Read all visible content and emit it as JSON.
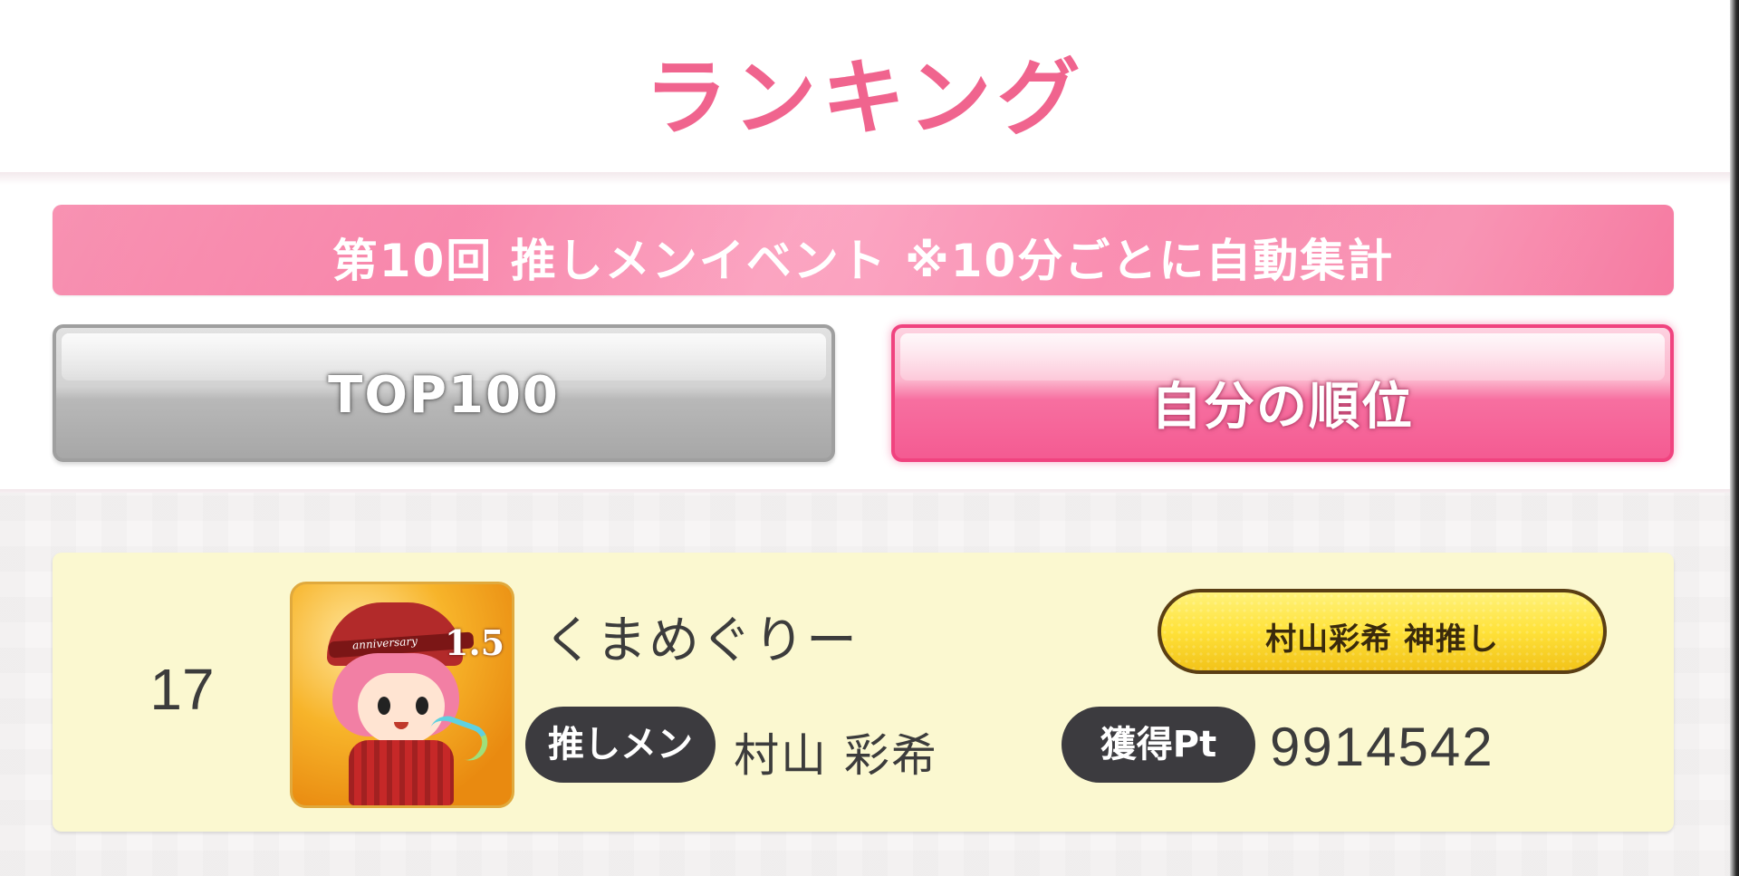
{
  "header": {
    "title": "ランキング"
  },
  "event_banner": {
    "text": "第10回 推しメンイベント ※10分ごとに自動集計"
  },
  "tabs": [
    {
      "label": "TOP100",
      "selected": false
    },
    {
      "label": "自分の順位",
      "selected": true
    }
  ],
  "ranking_entry": {
    "rank": "17",
    "player_name": "くまめぐりー",
    "avatar_text": {
      "band": "anniversary",
      "number": "1.5"
    },
    "title_badge": "村山彩希 神推し",
    "oshimen_label": "推しメン",
    "oshimen_name": "村山 彩希",
    "points_label": "獲得Pt",
    "points_value": "9914542"
  },
  "colors": {
    "title_pink": "#f0648e",
    "banner_pink": "#f67aa1",
    "tab_selected_pink": "#f45b92",
    "tab_unselected_gray": "#b8b8b8",
    "card_background": "#fbf8d0",
    "pill_dark": "#3c3b3f",
    "badge_gold": "#ffe23a"
  }
}
